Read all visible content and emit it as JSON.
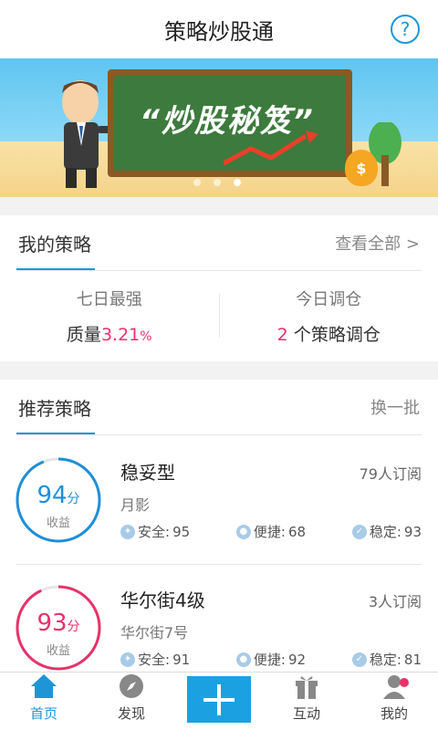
{
  "header": {
    "title": "策略炒股通",
    "help_label": "?"
  },
  "banner": {
    "board_text": "“炒股秘笈”",
    "bag_symbol": "$"
  },
  "my_strategy": {
    "title": "我的策略",
    "view_all": "查看全部 >",
    "left_label": "七日最强",
    "left_value_prefix": "质量",
    "left_value": "3.21",
    "left_value_unit": "%",
    "right_label": "今日调仓",
    "right_count": "2",
    "right_suffix": "个策略调仓"
  },
  "recommended": {
    "title": "推荐策略",
    "refresh": "换一批",
    "items": [
      {
        "name": "稳妥型",
        "subscribers": "79人订阅",
        "author": "月影",
        "score": "94",
        "score_unit": "分",
        "score_label": "收益",
        "score_fraction": 0.94,
        "ring_color": "#1e8fd9",
        "safety_label": "安全:",
        "safety": "95",
        "convenience_label": "便捷:",
        "convenience": "68",
        "stability_label": "稳定:",
        "stability": "93"
      },
      {
        "name": "华尔街4级",
        "subscribers": "3人订阅",
        "author": "华尔街7号",
        "score": "93",
        "score_unit": "分",
        "score_label": "收益",
        "score_fraction": 0.93,
        "ring_color": "#e8326a",
        "safety_label": "安全:",
        "safety": "91",
        "convenience_label": "便捷:",
        "convenience": "92",
        "stability_label": "稳定:",
        "stability": "81"
      }
    ]
  },
  "tabbar": {
    "home": "首页",
    "discover": "发现",
    "interact": "互动",
    "mine": "我的"
  },
  "colors": {
    "accent": "#1e96d6",
    "highlight": "#e8326a"
  }
}
